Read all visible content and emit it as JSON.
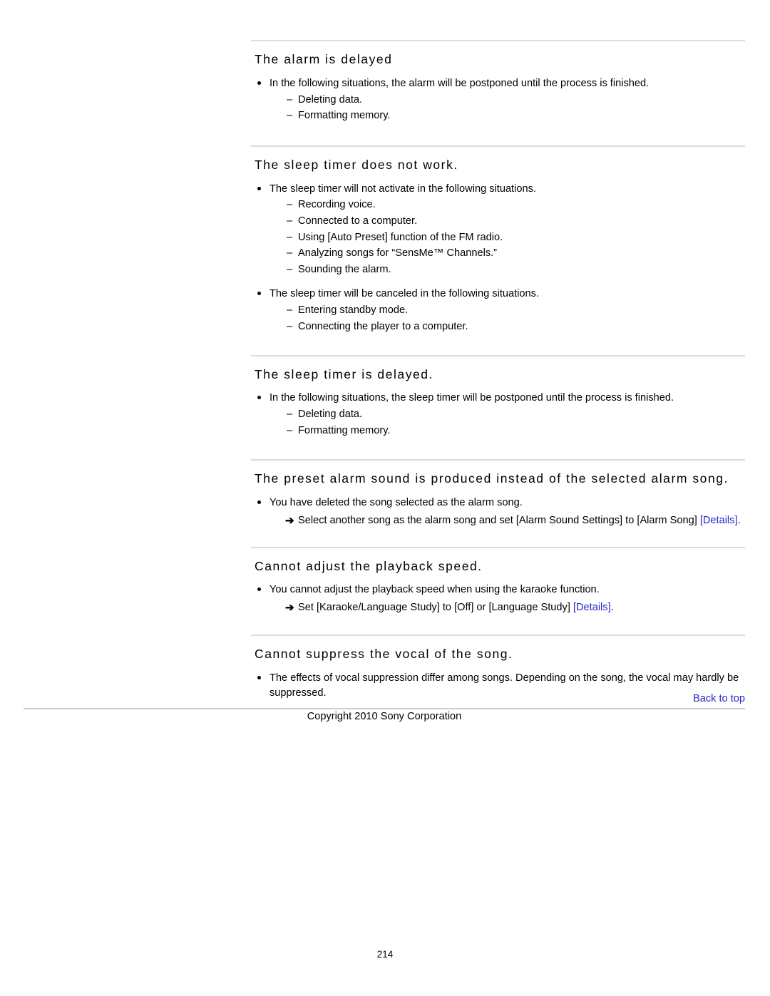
{
  "document": {
    "page_number": "214",
    "copyright": "Copyright 2010 Sony Corporation",
    "back_to_top": "Back to top",
    "link_color": "#2727c8",
    "rule_color": "#dcdcdc"
  },
  "sections": [
    {
      "heading": "The alarm is delayed",
      "items": [
        {
          "bullet": "In the following situations, the alarm will be postponed until the process is finished.",
          "subitems": [
            "Deleting data.",
            "Formatting memory."
          ]
        }
      ]
    },
    {
      "heading": "The sleep timer does not work.",
      "items": [
        {
          "bullet": "The sleep timer will not activate in the following situations.",
          "subitems": [
            "Recording voice.",
            "Connected to a computer.",
            "Using [Auto Preset] function of the FM radio.",
            "Analyzing songs for “SensMe™ Channels.”",
            "Sounding the alarm."
          ]
        },
        {
          "bullet": "The sleep timer will be canceled in the following situations.",
          "subitems": [
            "Entering standby mode.",
            "Connecting the player to a computer."
          ]
        }
      ]
    },
    {
      "heading": "The sleep timer is delayed.",
      "items": [
        {
          "bullet": "In the following situations, the sleep timer will be postponed until the process is finished.",
          "subitems": [
            "Deleting data.",
            "Formatting memory."
          ]
        }
      ]
    },
    {
      "heading": "The preset alarm sound is produced instead of the selected alarm song.",
      "items": [
        {
          "bullet": "You have deleted the song selected as the alarm song.",
          "arrow_before": "Select another song as the alarm song and set [Alarm Sound Settings] to [Alarm Song] ",
          "arrow_link": "[Details]",
          "arrow_after": "."
        }
      ]
    },
    {
      "heading": "Cannot adjust the playback speed.",
      "items": [
        {
          "bullet": "You cannot adjust the playback speed when using the karaoke function.",
          "arrow_before": "Set [Karaoke/Language Study] to [Off] or [Language Study] ",
          "arrow_link": "[Details]",
          "arrow_after": "."
        }
      ]
    },
    {
      "heading": "Cannot suppress the vocal of the song.",
      "items": [
        {
          "bullet": "The effects of vocal suppression differ among songs. Depending on the song, the vocal may hardly be suppressed."
        }
      ]
    }
  ],
  "glyphs": {
    "dash": "–",
    "arrow": "➔"
  }
}
